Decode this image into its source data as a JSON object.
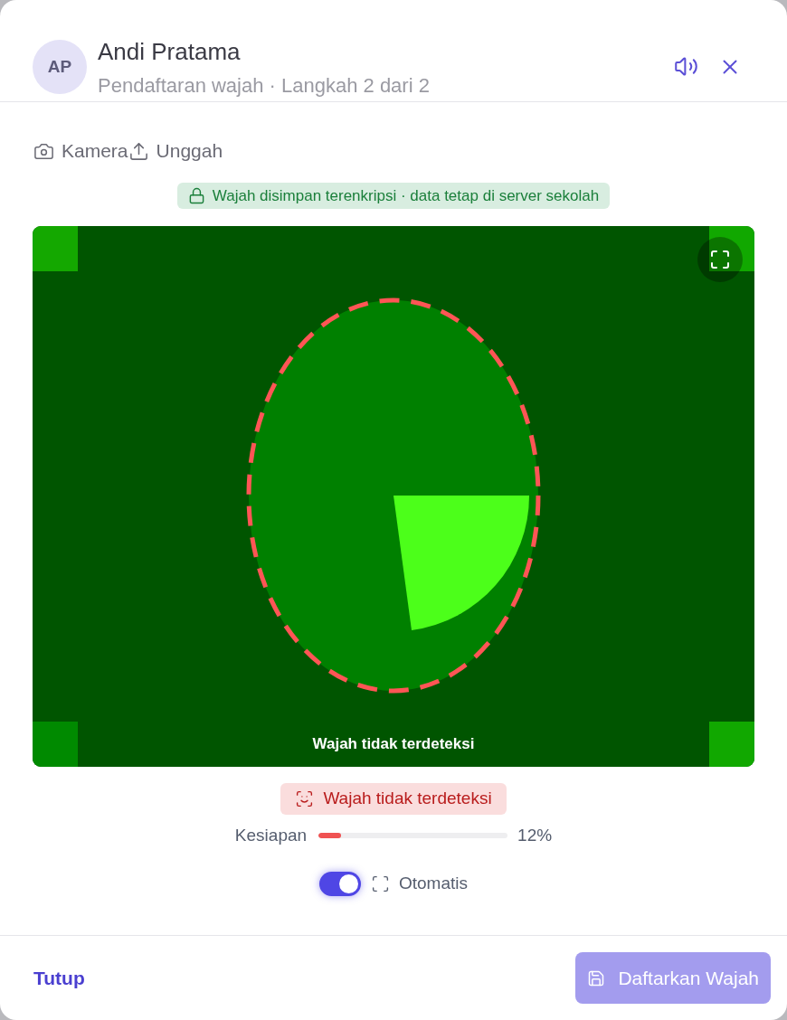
{
  "header": {
    "avatar_initials": "AP",
    "name": "Andi Pratama",
    "subtitle": "Pendaftaran wajah · Langkah 2 dari 2"
  },
  "tabs": [
    {
      "kind": "camera",
      "label": "Kamera"
    },
    {
      "kind": "upload",
      "label": "Unggah"
    }
  ],
  "privacy_note": {
    "text": "Wajah disimpan terenkripsi · data tetap di server sekolah"
  },
  "camera": {
    "face_detected": false,
    "caption": "Wajah tidak terdeteksi"
  },
  "status": {
    "text": "Wajah tidak terdeteksi"
  },
  "readiness": {
    "label": "Kesiapan",
    "level": 0.12,
    "reading": "12%"
  },
  "auto_capture": {
    "label": "Otomatis",
    "on": true
  },
  "footer": {
    "close_label": "Tutup",
    "submit": {
      "label": "Daftarkan Wajah",
      "disabled": true
    }
  }
}
